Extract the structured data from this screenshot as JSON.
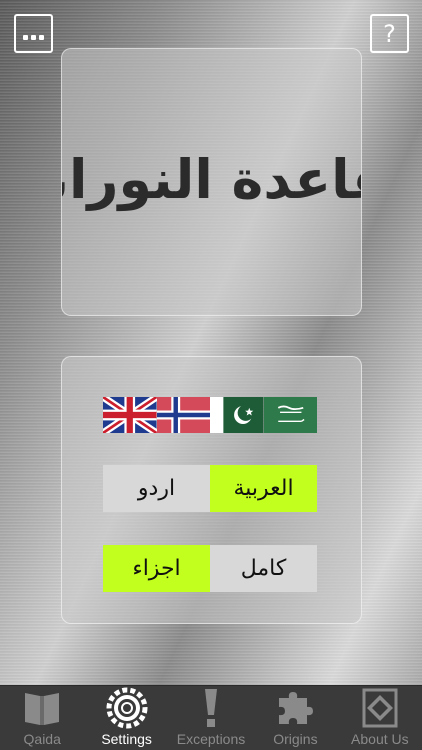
{
  "header": {
    "menu_icon": "more-dots-icon",
    "help_label": "?"
  },
  "logo": {
    "text": "القاعدة النورانية"
  },
  "flags": [
    {
      "name": "uk-flag",
      "country": "United Kingdom"
    },
    {
      "name": "norway-flag",
      "country": "Norway"
    },
    {
      "name": "pakistan-flag",
      "country": "Pakistan"
    },
    {
      "name": "saudi-flag",
      "country": "Saudi Arabia"
    }
  ],
  "language_toggle": {
    "right_label": "العربية",
    "left_label": "اردو",
    "selected": "العربية"
  },
  "mode_toggle": {
    "right_label": "كامل",
    "left_label": "اجزاء",
    "selected": "اجزاء"
  },
  "tabs": [
    {
      "label": "Qaida",
      "icon": "book-icon",
      "active": false
    },
    {
      "label": "Settings",
      "icon": "gear-icon",
      "active": true
    },
    {
      "label": "Exceptions",
      "icon": "exclamation-icon",
      "active": false
    },
    {
      "label": "Origins",
      "icon": "puzzle-icon",
      "active": false
    },
    {
      "label": "About Us",
      "icon": "diamond-icon",
      "active": false
    }
  ],
  "colors": {
    "selected": "#c3ff1e",
    "unselected": "#d8d8d8",
    "tabbar": "#3a3a3a"
  }
}
